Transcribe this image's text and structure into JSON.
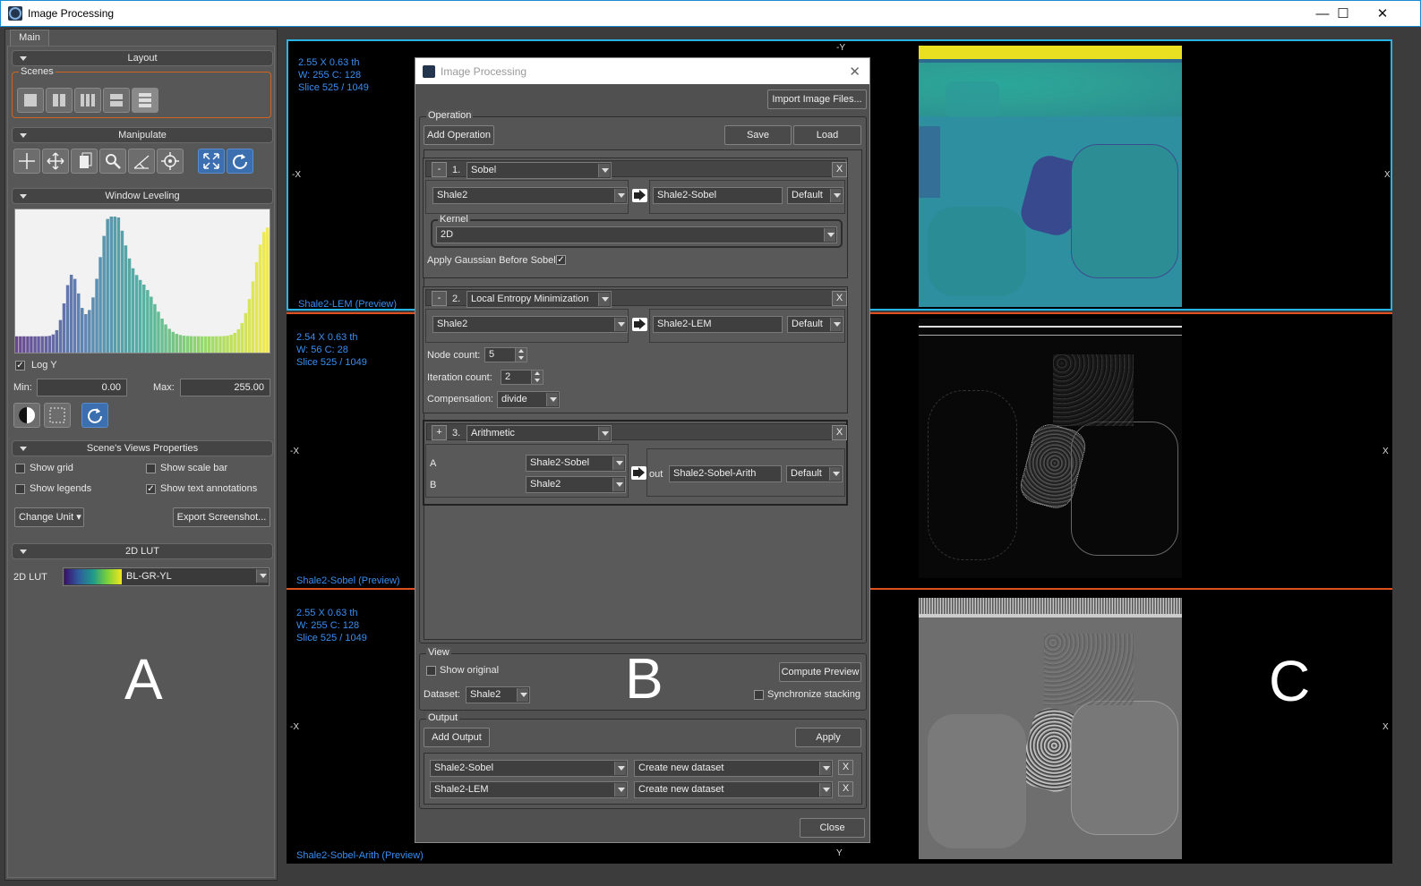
{
  "window": {
    "title": "Image Processing",
    "minimize": "—",
    "maximize": "☐",
    "close": "✕"
  },
  "left_panel": {
    "tab": "Main",
    "layout": {
      "header": "Layout",
      "scenes_label": "Scenes"
    },
    "manipulate": {
      "header": "Manipulate"
    },
    "window_leveling": {
      "header": "Window Leveling",
      "log_y_label": "Log Y",
      "log_y_checked": true,
      "min_label": "Min:",
      "min_value": "0.00",
      "max_label": "Max:",
      "max_value": "255.00"
    },
    "scene_views": {
      "header": "Scene's Views Properties",
      "show_grid": "Show grid",
      "show_scale_bar": "Show scale bar",
      "show_legends": "Show legends",
      "show_text_annotations": "Show text annotations",
      "show_text_annotations_checked": true,
      "change_unit": "Change Unit",
      "export_screenshot": "Export Screenshot..."
    },
    "lut": {
      "header": "2D LUT",
      "label": "2D LUT",
      "value": "BL-GR-YL"
    },
    "big_letter": "A"
  },
  "views": [
    {
      "line1": "2.55 X 0.63 th",
      "line2": "W: 255 C: 128",
      "line3": "Slice 525 / 1049",
      "caption": "Shale2-LEM (Preview)",
      "border_color": "#29b4e6"
    },
    {
      "line1": "2.54 X 0.63 th",
      "line2": "W: 56 C: 28",
      "line3": "Slice 525 / 1049",
      "caption": "Shale2-Sobel (Preview)",
      "border_color": "#e0501e"
    },
    {
      "line1": "2.55 X 0.63 th",
      "line2": "W: 255 C: 128",
      "line3": "Slice 525 / 1049",
      "caption": "Shale2-Sobel-Arith (Preview)",
      "border_color": "#e0501e"
    }
  ],
  "axes": {
    "neg_y": "-Y",
    "neg_x": "-X",
    "x": "X",
    "y": "Y"
  },
  "big_letter_c": "C",
  "dialog": {
    "title": "Image Processing",
    "import_button": "Import Image Files...",
    "operation_group": "Operation",
    "add_operation": "Add Operation",
    "save": "Save",
    "load": "Load",
    "ops": [
      {
        "toggle": "-",
        "index": "1.",
        "name": "Sobel",
        "input": "Shale2",
        "output": "Shale2-Sobel",
        "mode": "Default",
        "kernel_label": "Kernel",
        "kernel_value": "2D",
        "gaussian_label": "Apply Gaussian Before Sobel",
        "gaussian_checked": true
      },
      {
        "toggle": "-",
        "index": "2.",
        "name": "Local Entropy Minimization",
        "input": "Shale2",
        "output": "Shale2-LEM",
        "mode": "Default",
        "node_label": "Node count:",
        "node_value": "5",
        "iter_label": "Iteration count:",
        "iter_value": "2",
        "comp_label": "Compensation:",
        "comp_value": "divide"
      },
      {
        "toggle": "+",
        "index": "3.",
        "name": "Arithmetic",
        "a_label": "A",
        "a_value": "Shale2-Sobel",
        "b_label": "B",
        "b_value": "Shale2",
        "out_label": "out",
        "output": "Shale2-Sobel-Arith",
        "mode": "Default"
      }
    ],
    "remove_glyph": "X",
    "view_group": "View",
    "show_original": "Show original",
    "compute_preview": "Compute Preview",
    "dataset_label": "Dataset:",
    "dataset_value": "Shale2",
    "sync_stacking": "Synchronize stacking",
    "output_group": "Output",
    "add_output": "Add Output",
    "apply": "Apply",
    "outputs": [
      {
        "name": "Shale2-Sobel",
        "target": "Create new dataset"
      },
      {
        "name": "Shale2-LEM",
        "target": "Create new dataset"
      }
    ],
    "close": "Close",
    "big_letter": "B"
  }
}
